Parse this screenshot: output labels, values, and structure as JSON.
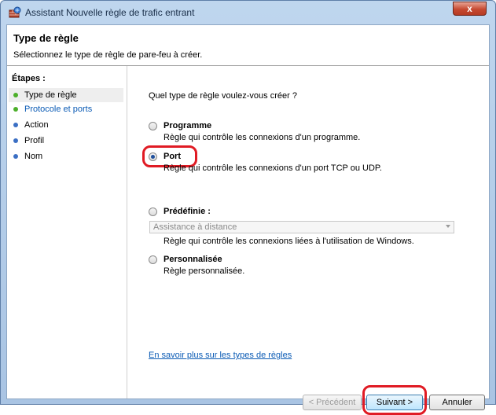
{
  "window": {
    "title": "Assistant Nouvelle règle de trafic entrant",
    "close_label": "x"
  },
  "header": {
    "title": "Type de règle",
    "subtitle": "Sélectionnez le type de règle de pare-feu à créer."
  },
  "steps": {
    "title": "Étapes :",
    "items": [
      {
        "label": "Type de règle",
        "state": "current",
        "dot": "#4caf2a"
      },
      {
        "label": "Protocole et ports",
        "state": "next",
        "dot": "#4caf2a"
      },
      {
        "label": "Action",
        "state": "pending",
        "dot": "#3b6fc4"
      },
      {
        "label": "Profil",
        "state": "pending",
        "dot": "#3b6fc4"
      },
      {
        "label": "Nom",
        "state": "pending",
        "dot": "#3b6fc4"
      }
    ]
  },
  "main": {
    "question": "Quel type de règle voulez-vous créer ?",
    "options": [
      {
        "label": "Programme",
        "desc": "Règle qui contrôle les connexions d'un programme.",
        "selected": false
      },
      {
        "label": "Port",
        "desc": "Règle qui contrôle les connexions d'un port TCP ou UDP.",
        "selected": true
      },
      {
        "label": "Prédéfinie :",
        "desc": "Règle qui contrôle les connexions liées à l'utilisation de Windows.",
        "selected": false
      },
      {
        "label": "Personnalisée",
        "desc": "Règle personnalisée.",
        "selected": false
      }
    ],
    "predefined_select": {
      "value": "Assistance à distance"
    },
    "learn_more": "En savoir plus sur les types de règles"
  },
  "buttons": {
    "previous": "< Précédent",
    "next": "Suivant >",
    "cancel": "Annuler"
  },
  "colors": {
    "highlight": "#e01b24",
    "link": "#0b5bb5",
    "step_done": "#4caf2a",
    "step_pending": "#3b6fc4"
  }
}
